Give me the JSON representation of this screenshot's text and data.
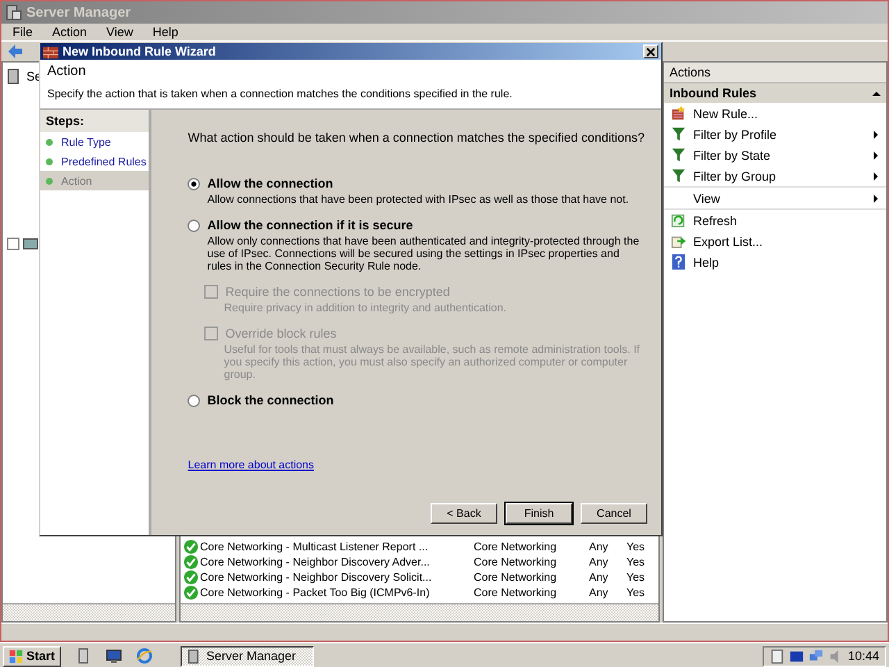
{
  "window": {
    "title": "Server Manager"
  },
  "menu": [
    "File",
    "Action",
    "View",
    "Help"
  ],
  "tree": [
    {
      "label": "Se"
    }
  ],
  "rules": {
    "rows": [
      {
        "name": "Core Networking - Multicast Listener Report ...",
        "group": "Core Networking",
        "profile": "Any",
        "enabled": "Yes"
      },
      {
        "name": "Core Networking - Neighbor Discovery Adver...",
        "group": "Core Networking",
        "profile": "Any",
        "enabled": "Yes"
      },
      {
        "name": "Core Networking - Neighbor Discovery Solicit...",
        "group": "Core Networking",
        "profile": "Any",
        "enabled": "Yes"
      },
      {
        "name": "Core Networking - Packet Too Big (ICMPv6-In)",
        "group": "Core Networking",
        "profile": "Any",
        "enabled": "Yes"
      }
    ]
  },
  "actions_pane": {
    "title": "Actions",
    "section": "Inbound Rules",
    "items": [
      {
        "label": "New Rule...",
        "kind": "new",
        "has_submenu": false
      },
      {
        "label": "Filter by Profile",
        "kind": "filter",
        "has_submenu": true
      },
      {
        "label": "Filter by State",
        "kind": "filter",
        "has_submenu": true
      },
      {
        "label": "Filter by Group",
        "kind": "filter",
        "has_submenu": true
      },
      {
        "label": "View",
        "kind": "plain",
        "has_submenu": true
      },
      {
        "label": "Refresh",
        "kind": "refresh",
        "has_submenu": false
      },
      {
        "label": "Export List...",
        "kind": "export",
        "has_submenu": false
      },
      {
        "label": "Help",
        "kind": "help",
        "has_submenu": false
      }
    ]
  },
  "wizard": {
    "title": "New Inbound Rule Wizard",
    "page_title": "Action",
    "page_subtitle": "Specify the action that is taken when a connection matches the conditions specified in the rule.",
    "steps_heading": "Steps:",
    "steps": [
      {
        "label": "Rule Type",
        "selected": false
      },
      {
        "label": "Predefined Rules",
        "selected": false
      },
      {
        "label": "Action",
        "selected": true
      }
    ],
    "question": "What action should be taken when a connection matches the specified conditions?",
    "options": [
      {
        "kind": "radio",
        "label": "Allow the connection",
        "selected": true,
        "disabled": false,
        "description": "Allow connections that have been protected with IPsec as well as those that have not."
      },
      {
        "kind": "radio",
        "label": "Allow the connection if it is secure",
        "selected": false,
        "disabled": false,
        "description": "Allow only connections that have been authenticated and integrity-protected through the use of IPsec. Connections will be secured using the settings in IPsec properties and rules in the Connection Security Rule node."
      },
      {
        "kind": "checkbox",
        "label": "Require the connections to be encrypted",
        "checked": false,
        "disabled": true,
        "description": "Require privacy in addition to integrity and authentication."
      },
      {
        "kind": "checkbox",
        "label": "Override block rules",
        "checked": false,
        "disabled": true,
        "description": "Useful for tools that must always be available, such as remote administration tools. If you specify this action, you must also specify an authorized computer or computer group."
      },
      {
        "kind": "radio",
        "label": "Block the connection",
        "selected": false,
        "disabled": false
      }
    ],
    "link": "Learn more about actions",
    "buttons": [
      {
        "label": "< Back",
        "default": false
      },
      {
        "label": "Finish",
        "default": true
      },
      {
        "label": "Cancel",
        "default": false
      }
    ]
  },
  "taskbar": {
    "start": "Start",
    "tasks": [
      {
        "label": "Server Manager"
      }
    ],
    "clock": "10:44"
  }
}
